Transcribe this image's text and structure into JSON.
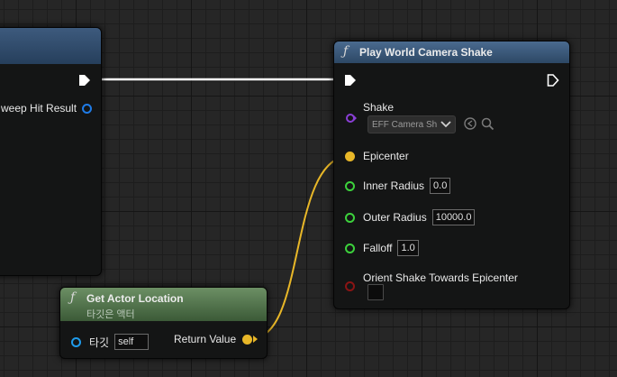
{
  "colors": {
    "exec_wire": "#ffffff",
    "vector_wire": "#e8b728",
    "float_pin": "#3cd13c",
    "object_pin": "#8a3fd6",
    "struct_pin": "#1f7be6",
    "bool_pin": "#8a1414",
    "func_header_blue": "#3a5578",
    "pure_header_green": "#5e7d57"
  },
  "partial_node": {
    "output_pin_label": "weep Hit Result",
    "output_pin_icon": "struct-pin-icon"
  },
  "play_shake_node": {
    "title": "Play World Camera Shake",
    "title_icon": "function-icon",
    "pins": {
      "shake": {
        "label": "Shake",
        "value": "EFF Camera Sh",
        "icon": "object-pin-icon"
      },
      "epicenter": {
        "label": "Epicenter"
      },
      "inner_radius": {
        "label": "Inner Radius",
        "value": "0.0"
      },
      "outer_radius": {
        "label": "Outer Radius",
        "value": "10000.0"
      },
      "falloff": {
        "label": "Falloff",
        "value": "1.0"
      },
      "orient": {
        "label": "Orient Shake Towards Epicenter",
        "checked": false
      }
    }
  },
  "get_location_node": {
    "title": "Get Actor Location",
    "subtitle": "타깃은 액터",
    "title_icon": "function-icon",
    "target_label": "타깃",
    "target_value": "self",
    "return_label": "Return Value"
  }
}
